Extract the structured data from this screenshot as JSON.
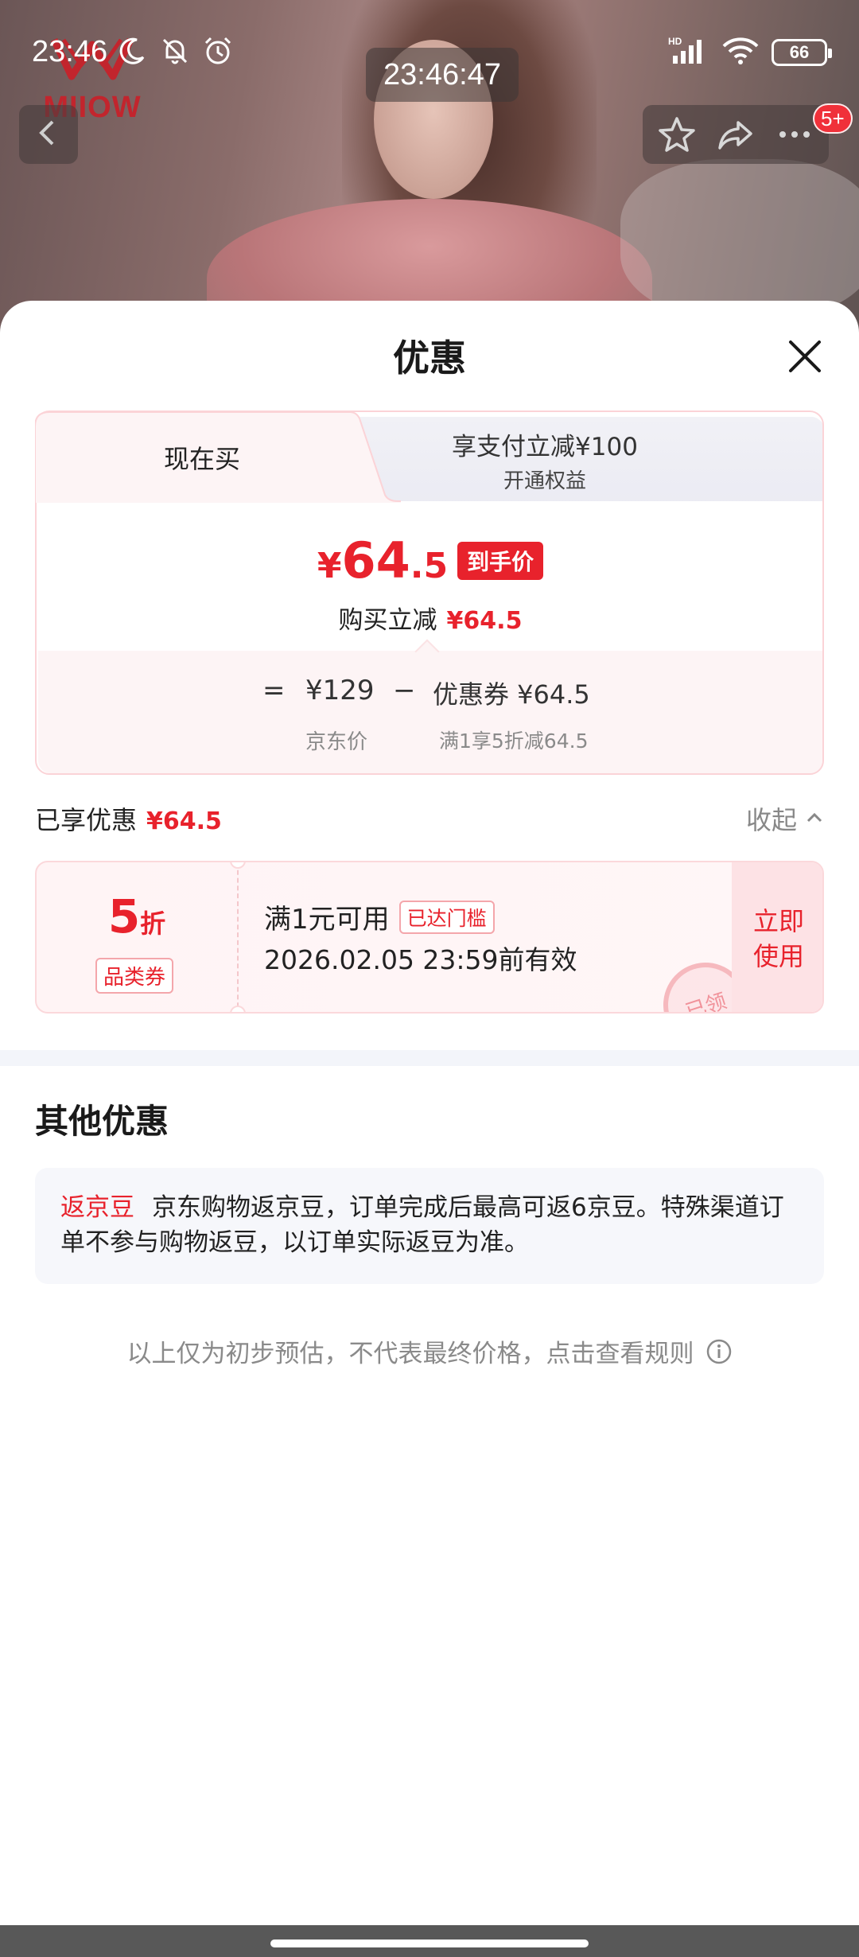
{
  "status_bar": {
    "time": "23:46",
    "screen_clock": "23:46:47",
    "battery": "66",
    "network_label": "HD"
  },
  "product_header": {
    "brand_logo_text": "MIIOW",
    "badge_count": "5+",
    "icons": [
      "back-icon",
      "star-icon",
      "share-icon",
      "more-icon"
    ]
  },
  "sheet": {
    "title": "优惠"
  },
  "tabs": {
    "active_label": "现在买",
    "other_line1": "享支付立减¥100",
    "other_line2": "开通权益"
  },
  "price": {
    "currency": "¥",
    "integer": "64",
    "decimal": ".5",
    "tag": "到手价",
    "reduce_label": "购买立减",
    "reduce_amount": "¥64.5"
  },
  "formula": {
    "equals": "=",
    "jd_price": "¥129",
    "minus": "−",
    "coupon_value": "优惠券 ¥64.5",
    "jd_price_label": "京东价",
    "coupon_rule": "满1享5折减64.5"
  },
  "enjoyed": {
    "label": "已享优惠",
    "amount": "¥64.5",
    "collapse_label": "收起"
  },
  "coupon": {
    "discount_number": "5",
    "discount_unit": "折",
    "type": "品类券",
    "condition": "满1元可用",
    "reached_tag": "已达门槛",
    "expiry": "2026.02.05 23:59前有效",
    "stamp": "已领",
    "use_button": "立即\n使用"
  },
  "other": {
    "title": "其他优惠",
    "bean_tag": "返京豆",
    "bean_text": "京东购物返京豆，订单完成后最高可返6京豆。特殊渠道订单不参与购物返豆，以订单实际返豆为准。"
  },
  "disclaimer": "以上仅为初步预估，不代表最终价格，点击查看规则",
  "colors": {
    "accent_red": "#e8222c",
    "card_border": "#fbd3d7",
    "muted_text": "#8a8a8a"
  }
}
